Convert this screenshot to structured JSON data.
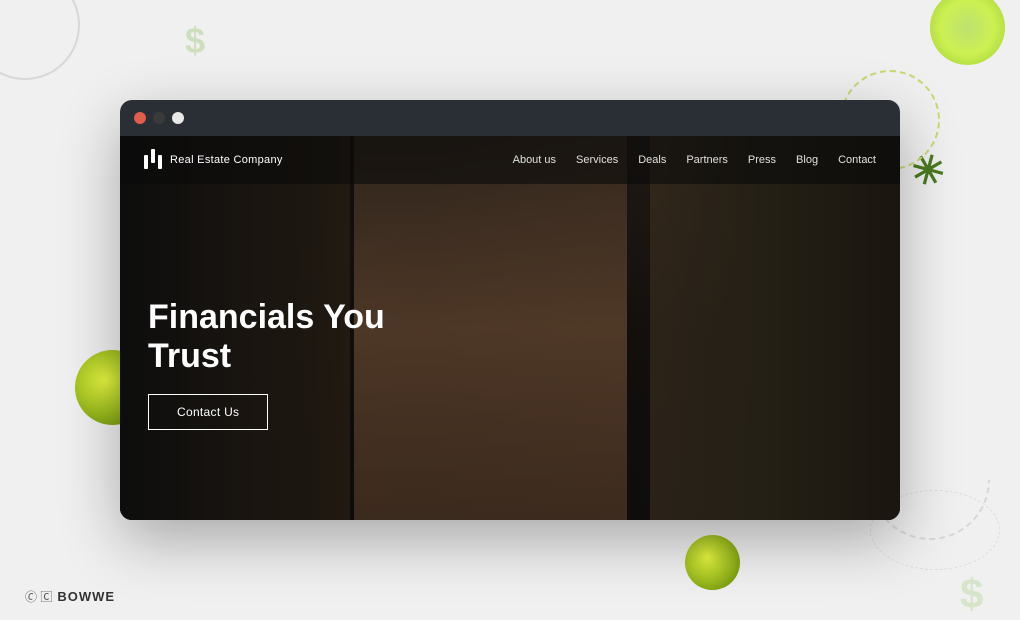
{
  "browser": {
    "dot_red_label": "close",
    "dot_yellow_label": "minimize",
    "dot_green_label": "maximize"
  },
  "website": {
    "logo_text": "Real Estate Company",
    "nav": {
      "items": [
        {
          "label": "About us"
        },
        {
          "label": "Services"
        },
        {
          "label": "Deals"
        },
        {
          "label": "Partners"
        },
        {
          "label": "Press"
        },
        {
          "label": "Blog"
        },
        {
          "label": "Contact"
        }
      ]
    },
    "hero": {
      "headline_line1": "Financials You",
      "headline_line2": "Trust",
      "cta_label": "Contact Us"
    }
  },
  "footer": {
    "brand": "BOWWE"
  },
  "decorative": {
    "dollar1": "$",
    "dollar2": "$",
    "dollar3": "$"
  }
}
